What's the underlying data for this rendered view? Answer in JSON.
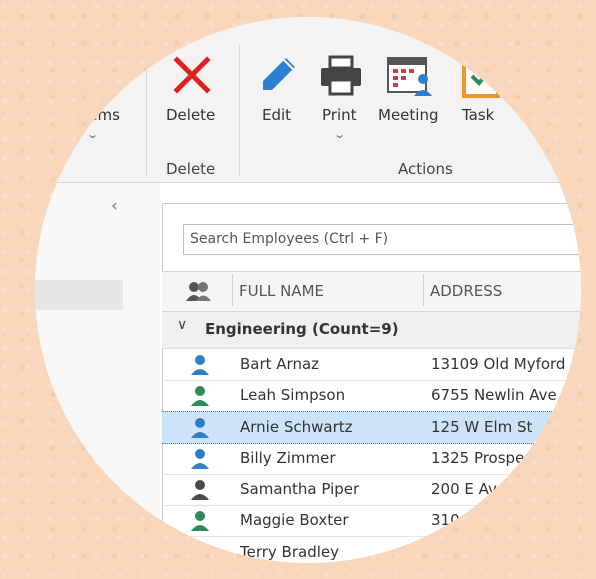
{
  "ribbon": {
    "items_label": "Items",
    "delete_label": "Delete",
    "edit_label": "Edit",
    "print_label": "Print",
    "meeting_label": "Meeting",
    "task_label": "Task",
    "group_delete": "Delete",
    "group_actions": "Actions"
  },
  "grid": {
    "search_placeholder": "Search Employees (Ctrl + F)",
    "col_fullname": "FULL NAME",
    "col_address": "ADDRESS",
    "group_label": "Engineering (Count=9)",
    "rows": [
      {
        "name": "Bart Arnaz",
        "address": "13109 Old Myford",
        "icon_color": "#2e7fc8"
      },
      {
        "name": "Leah Simpson",
        "address": "6755 Newlin Ave",
        "icon_color": "#2e8b57"
      },
      {
        "name": "Arnie Schwartz",
        "address": "125 W Elm St",
        "icon_color": "#2e7fc8"
      },
      {
        "name": "Billy Zimmer",
        "address": "1325 Prospe",
        "icon_color": "#2e7fc8"
      },
      {
        "name": "Samantha Piper",
        "address": "200 E Av",
        "icon_color": "#4a4a4a"
      },
      {
        "name": "Maggie Boxter",
        "address": "310",
        "icon_color": "#2e8b57"
      },
      {
        "name": "Terry Bradley",
        "address": "",
        "icon_color": "#4a4a4a"
      }
    ]
  },
  "colors": {
    "selected_row": "#cde3f7",
    "delete_red": "#e02020",
    "edit_blue": "#2d7fd3"
  }
}
